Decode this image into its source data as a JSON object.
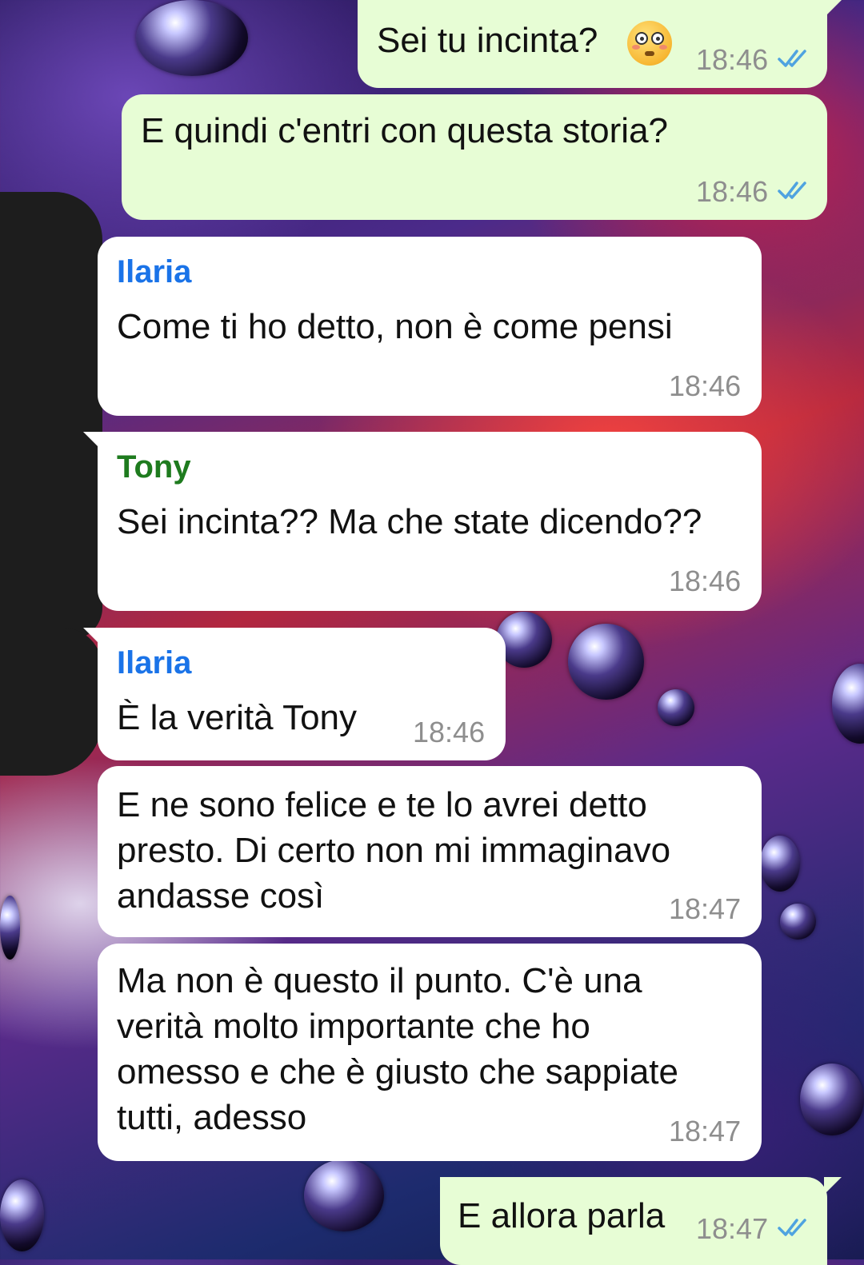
{
  "colors": {
    "outgoing_bubble": "#e7fdd5",
    "incoming_bubble": "#ffffff",
    "sender_ilaria": "#1a73e8",
    "sender_tony": "#1e7b1e",
    "read_ticks": "#4fa3e0",
    "timestamp": "#8e8e8e"
  },
  "messages": [
    {
      "direction": "out",
      "text": "Sei tu incinta?",
      "emoji": "flushed-face",
      "time": "18:46",
      "status": "read"
    },
    {
      "direction": "out",
      "text": "E quindi c'entri con questa storia?",
      "time": "18:46",
      "status": "read"
    },
    {
      "direction": "in",
      "sender": "Ilaria",
      "text": "Come ti ho detto, non è come pensi",
      "time": "18:46"
    },
    {
      "direction": "in",
      "sender": "Tony",
      "text": "Sei incinta?? Ma che state dicendo??",
      "time": "18:46"
    },
    {
      "direction": "in",
      "sender": "Ilaria",
      "text": "È la verità Tony",
      "time": "18:46"
    },
    {
      "direction": "in",
      "lines": [
        "E ne sono felice e te lo avrei detto",
        "presto. Di certo non mi immaginavo",
        "andasse così"
      ],
      "time": "18:47"
    },
    {
      "direction": "in",
      "lines": [
        "Ma non è questo il punto. C'è una",
        "verità molto importante che ho",
        "omesso e che è giusto che sappiate",
        "tutti, adesso"
      ],
      "time": "18:47"
    },
    {
      "direction": "out",
      "text": "E allora parla",
      "time": "18:47",
      "status": "read"
    }
  ]
}
